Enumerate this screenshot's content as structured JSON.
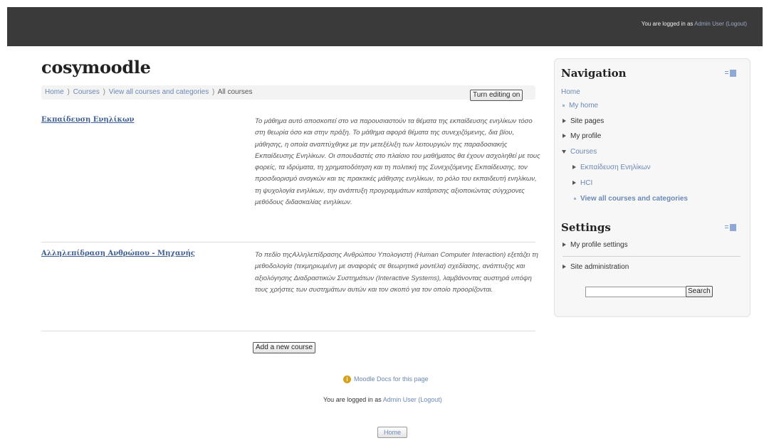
{
  "topbar": {
    "login_prefix": "You are logged in as ",
    "user": "Admin User",
    "logout": "(Logout)"
  },
  "site": {
    "title": "cosymoodle"
  },
  "breadcrumb": {
    "items": [
      "Home",
      "Courses",
      "View all courses and categories"
    ],
    "current": "All courses",
    "separator": ")"
  },
  "buttons": {
    "turn_editing_on": "Turn editing on",
    "add_course": "Add a new course",
    "search": "Search",
    "home": "Home"
  },
  "courses": [
    {
      "name": "Εκπαίδευση Ενηλίκων",
      "summary": "Το μάθημα αυτό αποσκοπεί στο να παρουσιαστούν τα θέματα της εκπαίδευσης ενηλίκων τόσο στη θεωρία όσο και στην πράξη. Το μάθημα αφορά θέματα της συνεχιζόμενης, δια βίου, μάθησης, η οποία αναπτύχθηκε με την μετεξέλιξη των λειτουργιών της παραδοσιακής Εκπαίδευσης Ενηλίκων. Οι σπουδαστές στο πλαίσιο του μαθήματος θα έχουν ασχοληθεί με τους φορείς, τα ιδρύματα, τη χρηματοδότηση και τη πολιτική της Συνεχιζόμενης Εκπαίδευσης, τον προσδιορισμό αναγκών και τις πρακτικές μάθησης ενηλίκων, το ρόλο του εκπαιδευτή ενηλίκων, τη ψυχολογία ενηλίκων, την ανάπτυξη προγραμμάτων κατάρτισης αξιοποιώντας σύγχρονες μεθόδους διδασκαλίας ενηλίκων."
    },
    {
      "name": "Αλληλεπίδραση Ανθρώπου - Μηχανής",
      "summary": "Το πεδίο τηςΑλληλεπίδρασης Ανθρώπου Υπολογιστή (Human Computer Interaction) εξετάζει τη μεθοδολογία (τεκμηριωμένη με αναφορές σε θεωρητικά μοντέλα) σχεδίασης, ανάπτυξης και αξιολόγησης Διαδραστικών Συστημάτων (Interactive Systems), λαμβάνοντας αυστηρά υπόψη τους χρήστες των συστημάτων αυτών και τον σκοπό για τον οποίο προορίζονται."
    }
  ],
  "footer": {
    "docs_link": "Moodle Docs for this page",
    "login_prefix": "You are logged in as ",
    "user": "Admin User",
    "logout": "(Logout)"
  },
  "navigation": {
    "title": "Navigation",
    "home": "Home",
    "my_home": "My home",
    "site_pages": "Site pages",
    "my_profile": "My profile",
    "courses": "Courses",
    "course_1": "Εκπαίδευση Ενηλίκων",
    "course_2": "HCI",
    "view_all": "View all courses and categories"
  },
  "settings": {
    "title": "Settings",
    "my_profile_settings": "My profile settings",
    "site_administration": "Site administration"
  },
  "search": {
    "value": ""
  },
  "icons": {
    "dock": "dock-block-icon",
    "info": "moodle-docs-icon",
    "collapsed": "triangle-right-icon",
    "expanded": "triangle-down-icon",
    "leaf": "bullet-icon"
  },
  "colors": {
    "topbar": "#3a3a3a",
    "link": "#6b88b5",
    "course_link": "#3f5f94",
    "block_bg": "#f7f7f7"
  }
}
